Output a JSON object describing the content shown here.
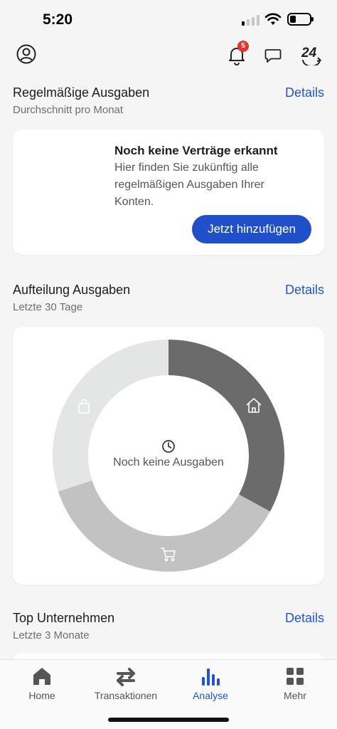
{
  "status_bar": {
    "time": "5:20",
    "signal_bars": 4,
    "signal_active_bars": 1,
    "battery_level": 0.3
  },
  "toolbar": {
    "icons": [
      "profile-icon",
      "bell-icon",
      "chat-icon",
      "service-24-icon"
    ],
    "notification_count": "5"
  },
  "regular_expenses": {
    "title": "Regelmäßige Ausgaben",
    "subtitle": "Durchschnitt pro Monat",
    "details": "Details",
    "empty_title": "Noch keine Verträge erkannt",
    "empty_text": "Hier finden Sie zukünftig alle regelmäßigen Ausgaben Ihrer Konten.",
    "add_button": "Jetzt hinzufügen"
  },
  "expense_split": {
    "title": "Aufteilung Ausgaben",
    "subtitle": "Letzte 30 Tage",
    "details": "Details",
    "empty_label": "Noch keine Ausgaben",
    "segments": [
      {
        "icon": "home-icon",
        "share": 0.33,
        "color": "#6b6b6b"
      },
      {
        "icon": "cart-icon",
        "share": 0.37,
        "color": "#c2c2c2"
      },
      {
        "icon": "bag-icon",
        "share": 0.3,
        "color": "#e4e6e6"
      }
    ]
  },
  "top_companies": {
    "title": "Top Unternehmen",
    "subtitle": "Letzte 3 Monate",
    "details": "Details"
  },
  "tabbar": {
    "tabs": [
      {
        "label": "Home",
        "icon": "home-tab-icon"
      },
      {
        "label": "Transaktionen",
        "icon": "arrows-icon"
      },
      {
        "label": "Analyse",
        "icon": "bar-chart-icon",
        "active": true
      },
      {
        "label": "Mehr",
        "icon": "grid-icon"
      }
    ]
  },
  "colors": {
    "accent": "#2255cc",
    "button": "#1f4fc9",
    "badge": "#e5342f"
  }
}
